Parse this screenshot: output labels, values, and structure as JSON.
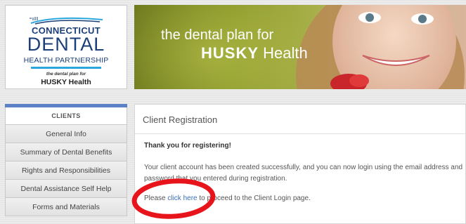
{
  "logo": {
    "line1": "CONNECTICUT",
    "line2": "DENTAL",
    "line3": "HEALTH PARTNERSHIP",
    "line4": "the dental plan for",
    "line5": "HUSKY Health"
  },
  "banner": {
    "tagline": "the dental plan for",
    "brand_bold": "HUSKY",
    "brand_regular": "Health"
  },
  "sidebar": {
    "header": "CLIENTS",
    "items": [
      {
        "label": "General Info"
      },
      {
        "label": "Summary of Dental Benefits"
      },
      {
        "label": "Rights and Responsibilities"
      },
      {
        "label": "Dental Assistance Self Help"
      },
      {
        "label": "Forms and Materials"
      }
    ]
  },
  "main": {
    "title": "Client Registration",
    "thanks": "Thank you for registering!",
    "message": "Your client account has been created successfully, and you can now login using the email address and password that you entered during registration.",
    "proceed_prefix": "Please",
    "proceed_link": "click here",
    "proceed_suffix": "to proceed to the Client Login page."
  },
  "colors": {
    "accent_blue": "#5b82c6",
    "link": "#3a6fb3",
    "annotation_red": "#e8141b",
    "logo_navy": "#1d3f79",
    "logo_cyan": "#2aa8de"
  }
}
